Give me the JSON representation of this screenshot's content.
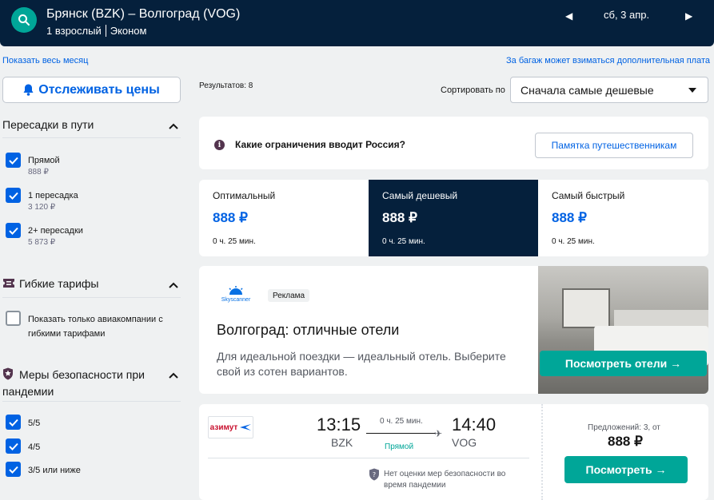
{
  "header": {
    "route": "Брянск (BZK) – Волгоград (VOG)",
    "passengers": "1 взрослый",
    "cabin": "Эконом",
    "date": "сб, 3 апр."
  },
  "top_links": {
    "show_month": "Показать весь месяц",
    "baggage_fee": "За багаж может взиматься дополнительная плата"
  },
  "sidebar": {
    "track_button": "Отслеживать цены",
    "stops_section": {
      "title": "Пересадки в пути",
      "options": [
        {
          "label": "Прямой",
          "price": "888 ₽",
          "checked": true
        },
        {
          "label": "1 пересадка",
          "price": "3 120 ₽",
          "checked": true
        },
        {
          "label": "2+ пересадки",
          "price": "5 873 ₽",
          "checked": true
        }
      ]
    },
    "flex_section": {
      "title": "Гибкие тарифы",
      "option_line1": "Показать только авиакомпании с",
      "option_line2": "гибкими тарифами"
    },
    "safety_section": {
      "title_line1": "Меры безопасности при",
      "title_line2": "пандемии",
      "options": [
        "5/5",
        "4/5",
        "3/5 или ниже"
      ]
    }
  },
  "results": {
    "count": "Результатов: 8",
    "sort_label": "Сортировать по",
    "sort_value": "Сначала самые дешевые"
  },
  "info_card": {
    "text": "Какие ограничения вводит Россия?",
    "button": "Памятка путешественникам"
  },
  "tabs": [
    {
      "label": "Оптимальный",
      "price": "888 ₽",
      "duration": "0 ч. 25 мин."
    },
    {
      "label": "Самый дешевый",
      "price": "888 ₽",
      "duration": "0 ч. 25 мин."
    },
    {
      "label": "Самый быстрый",
      "price": "888 ₽",
      "duration": "0 ч. 25 мин."
    }
  ],
  "ad": {
    "brand": "Skyscanner",
    "badge": "Реклама",
    "title": "Волгоград: отличные отели",
    "desc_line1": "Для идеальной поездки — идеальный отель. Выберите",
    "desc_line2": "свой из сотен вариантов.",
    "button": "Посмотреть отели →"
  },
  "flight": {
    "airline": "азимут",
    "dep_time": "13:15",
    "dep_code": "BZK",
    "arr_time": "14:40",
    "arr_code": "VOG",
    "duration": "0 ч. 25 мин.",
    "stops": "Прямой",
    "safety_line1": "Нет оценки мер безопасности во",
    "safety_line2": "время пандемии",
    "offers": "Предложений: 3, от",
    "price": "888 ₽",
    "button": "Посмотреть →"
  },
  "colors": {
    "header_bg": "#05203c",
    "accent_teal": "#00a698",
    "link_blue": "#0062e3"
  }
}
